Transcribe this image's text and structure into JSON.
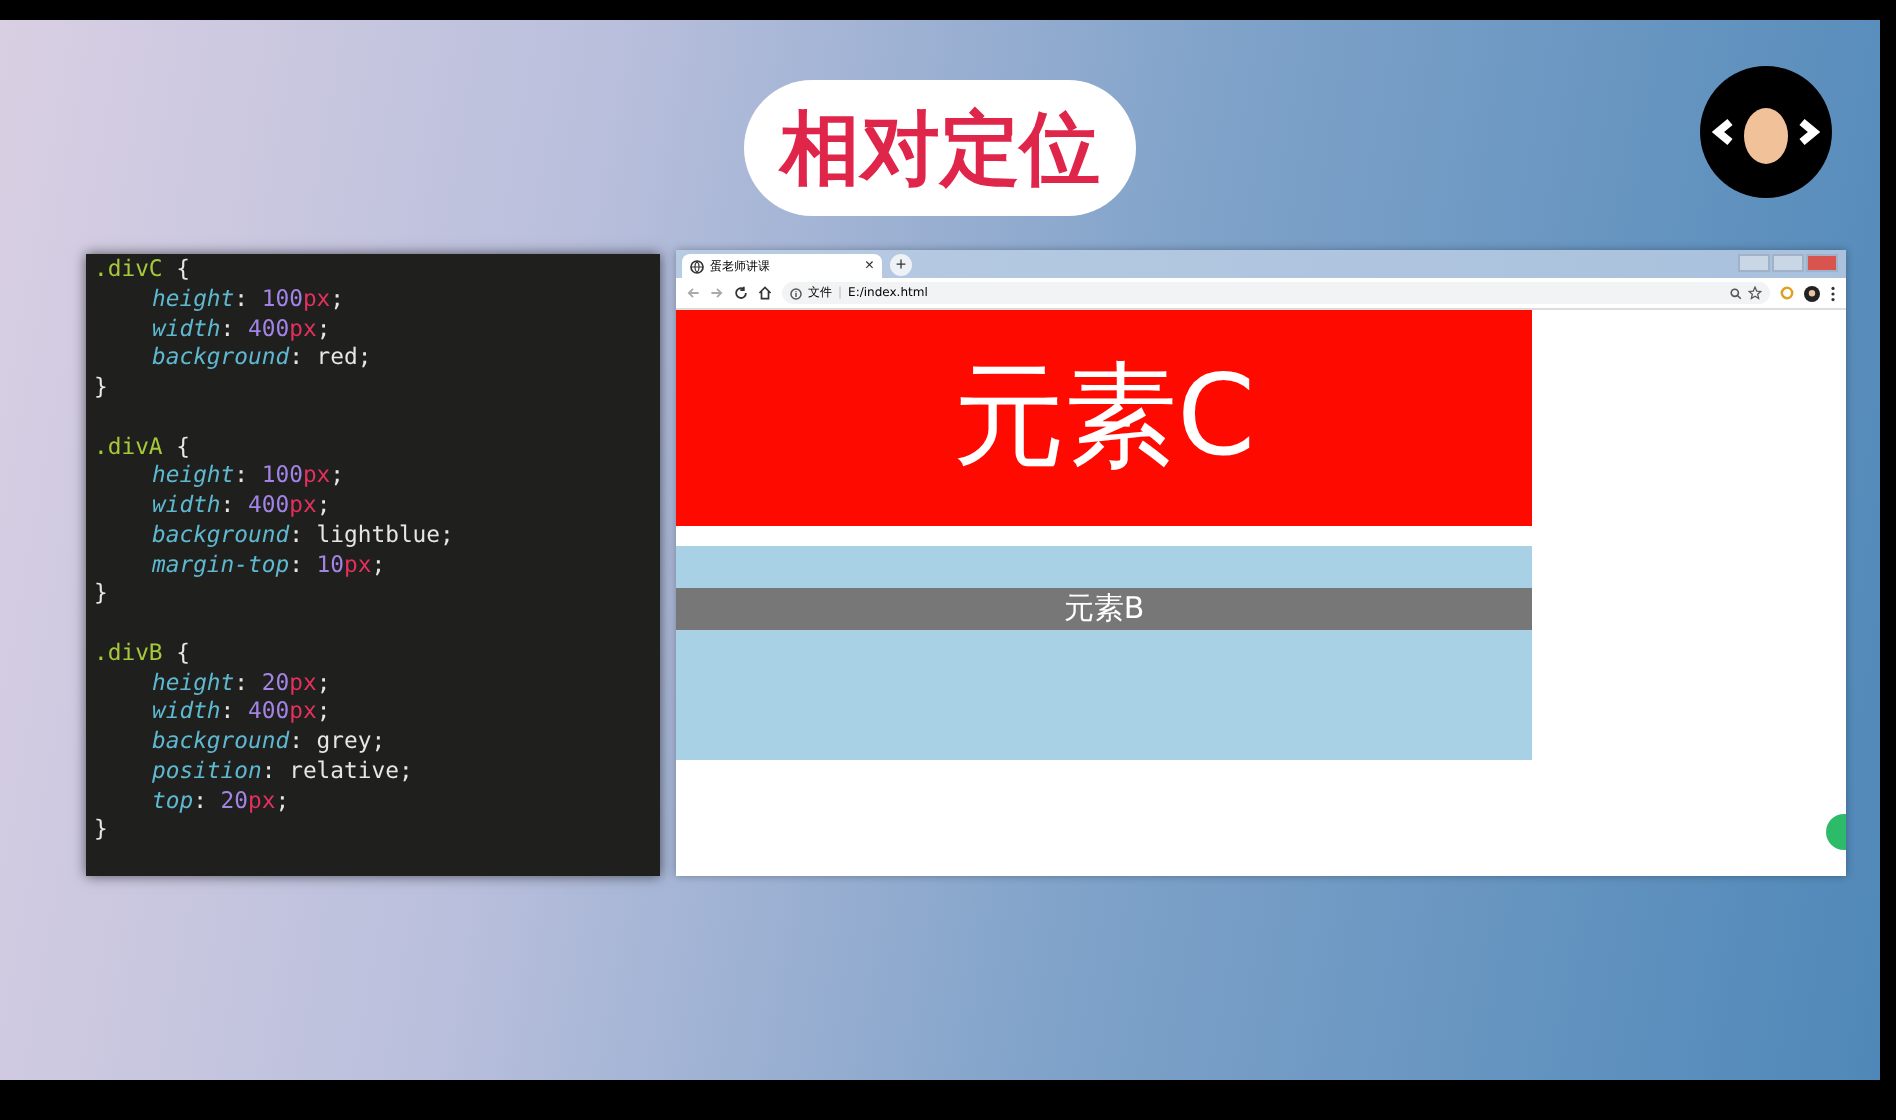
{
  "slide": {
    "title": "相对定位"
  },
  "code_editor": {
    "lines": [
      {
        "kind": "code",
        "indented": false,
        "tokens": [
          {
            "kind": "selector",
            "text": ".divC"
          },
          {
            "kind": "punct",
            "text": " {"
          }
        ]
      },
      {
        "kind": "code",
        "indented": true,
        "tokens": [
          {
            "kind": "property",
            "text": "height"
          },
          {
            "kind": "punct",
            "text": ": "
          },
          {
            "kind": "number",
            "text": "100"
          },
          {
            "kind": "unit",
            "text": "px"
          },
          {
            "kind": "punct",
            "text": ";"
          }
        ]
      },
      {
        "kind": "code",
        "indented": true,
        "tokens": [
          {
            "kind": "property",
            "text": "width"
          },
          {
            "kind": "punct",
            "text": ": "
          },
          {
            "kind": "number",
            "text": "400"
          },
          {
            "kind": "unit",
            "text": "px"
          },
          {
            "kind": "punct",
            "text": ";"
          }
        ]
      },
      {
        "kind": "code",
        "indented": true,
        "tokens": [
          {
            "kind": "property",
            "text": "background"
          },
          {
            "kind": "punct",
            "text": ": "
          },
          {
            "kind": "value",
            "text": "red"
          },
          {
            "kind": "punct",
            "text": ";"
          }
        ]
      },
      {
        "kind": "code",
        "indented": false,
        "tokens": [
          {
            "kind": "punct",
            "text": "}"
          }
        ]
      },
      {
        "kind": "blank"
      },
      {
        "kind": "code",
        "indented": false,
        "tokens": [
          {
            "kind": "selector",
            "text": ".divA"
          },
          {
            "kind": "punct",
            "text": " {"
          }
        ]
      },
      {
        "kind": "code",
        "indented": true,
        "tokens": [
          {
            "kind": "property",
            "text": "height"
          },
          {
            "kind": "punct",
            "text": ": "
          },
          {
            "kind": "number",
            "text": "100"
          },
          {
            "kind": "unit",
            "text": "px"
          },
          {
            "kind": "punct",
            "text": ";"
          }
        ]
      },
      {
        "kind": "code",
        "indented": true,
        "tokens": [
          {
            "kind": "property",
            "text": "width"
          },
          {
            "kind": "punct",
            "text": ": "
          },
          {
            "kind": "number",
            "text": "400"
          },
          {
            "kind": "unit",
            "text": "px"
          },
          {
            "kind": "punct",
            "text": ";"
          }
        ]
      },
      {
        "kind": "code",
        "indented": true,
        "tokens": [
          {
            "kind": "property",
            "text": "background"
          },
          {
            "kind": "punct",
            "text": ": "
          },
          {
            "kind": "value",
            "text": "lightblue"
          },
          {
            "kind": "punct",
            "text": ";"
          }
        ]
      },
      {
        "kind": "code",
        "indented": true,
        "tokens": [
          {
            "kind": "property",
            "text": "margin-top"
          },
          {
            "kind": "punct",
            "text": ": "
          },
          {
            "kind": "number",
            "text": "10"
          },
          {
            "kind": "unit",
            "text": "px"
          },
          {
            "kind": "punct",
            "text": ";"
          }
        ]
      },
      {
        "kind": "code",
        "indented": false,
        "tokens": [
          {
            "kind": "punct",
            "text": "}"
          }
        ]
      },
      {
        "kind": "blank"
      },
      {
        "kind": "code",
        "indented": false,
        "tokens": [
          {
            "kind": "selector",
            "text": ".divB"
          },
          {
            "kind": "punct",
            "text": " {"
          }
        ]
      },
      {
        "kind": "code",
        "indented": true,
        "tokens": [
          {
            "kind": "property",
            "text": "height"
          },
          {
            "kind": "punct",
            "text": ": "
          },
          {
            "kind": "number",
            "text": "20"
          },
          {
            "kind": "unit",
            "text": "px"
          },
          {
            "kind": "punct",
            "text": ";"
          }
        ]
      },
      {
        "kind": "code",
        "indented": true,
        "tokens": [
          {
            "kind": "property",
            "text": "width"
          },
          {
            "kind": "punct",
            "text": ": "
          },
          {
            "kind": "number",
            "text": "400"
          },
          {
            "kind": "unit",
            "text": "px"
          },
          {
            "kind": "punct",
            "text": ";"
          }
        ]
      },
      {
        "kind": "code",
        "indented": true,
        "tokens": [
          {
            "kind": "property",
            "text": "background"
          },
          {
            "kind": "punct",
            "text": ": "
          },
          {
            "kind": "value",
            "text": "grey"
          },
          {
            "kind": "punct",
            "text": ";"
          }
        ]
      },
      {
        "kind": "code",
        "indented": true,
        "tokens": [
          {
            "kind": "property",
            "text": "position"
          },
          {
            "kind": "punct",
            "text": ": "
          },
          {
            "kind": "value",
            "text": "relative"
          },
          {
            "kind": "punct",
            "text": ";"
          }
        ]
      },
      {
        "kind": "code",
        "indented": true,
        "tokens": [
          {
            "kind": "property",
            "text": "top"
          },
          {
            "kind": "punct",
            "text": ": "
          },
          {
            "kind": "number",
            "text": "20"
          },
          {
            "kind": "unit",
            "text": "px"
          },
          {
            "kind": "punct",
            "text": ";"
          }
        ]
      },
      {
        "kind": "code",
        "indented": false,
        "tokens": [
          {
            "kind": "punct",
            "text": "}"
          }
        ]
      }
    ]
  },
  "browser": {
    "tab": {
      "title": "蛋老师讲课",
      "close": "×"
    },
    "new_tab": "+",
    "address": {
      "label": "文件",
      "separator": "|",
      "url": "E:/index.html"
    },
    "page": {
      "div_c": {
        "text": "元素C"
      },
      "div_b": {
        "text": "元素B"
      }
    }
  }
}
